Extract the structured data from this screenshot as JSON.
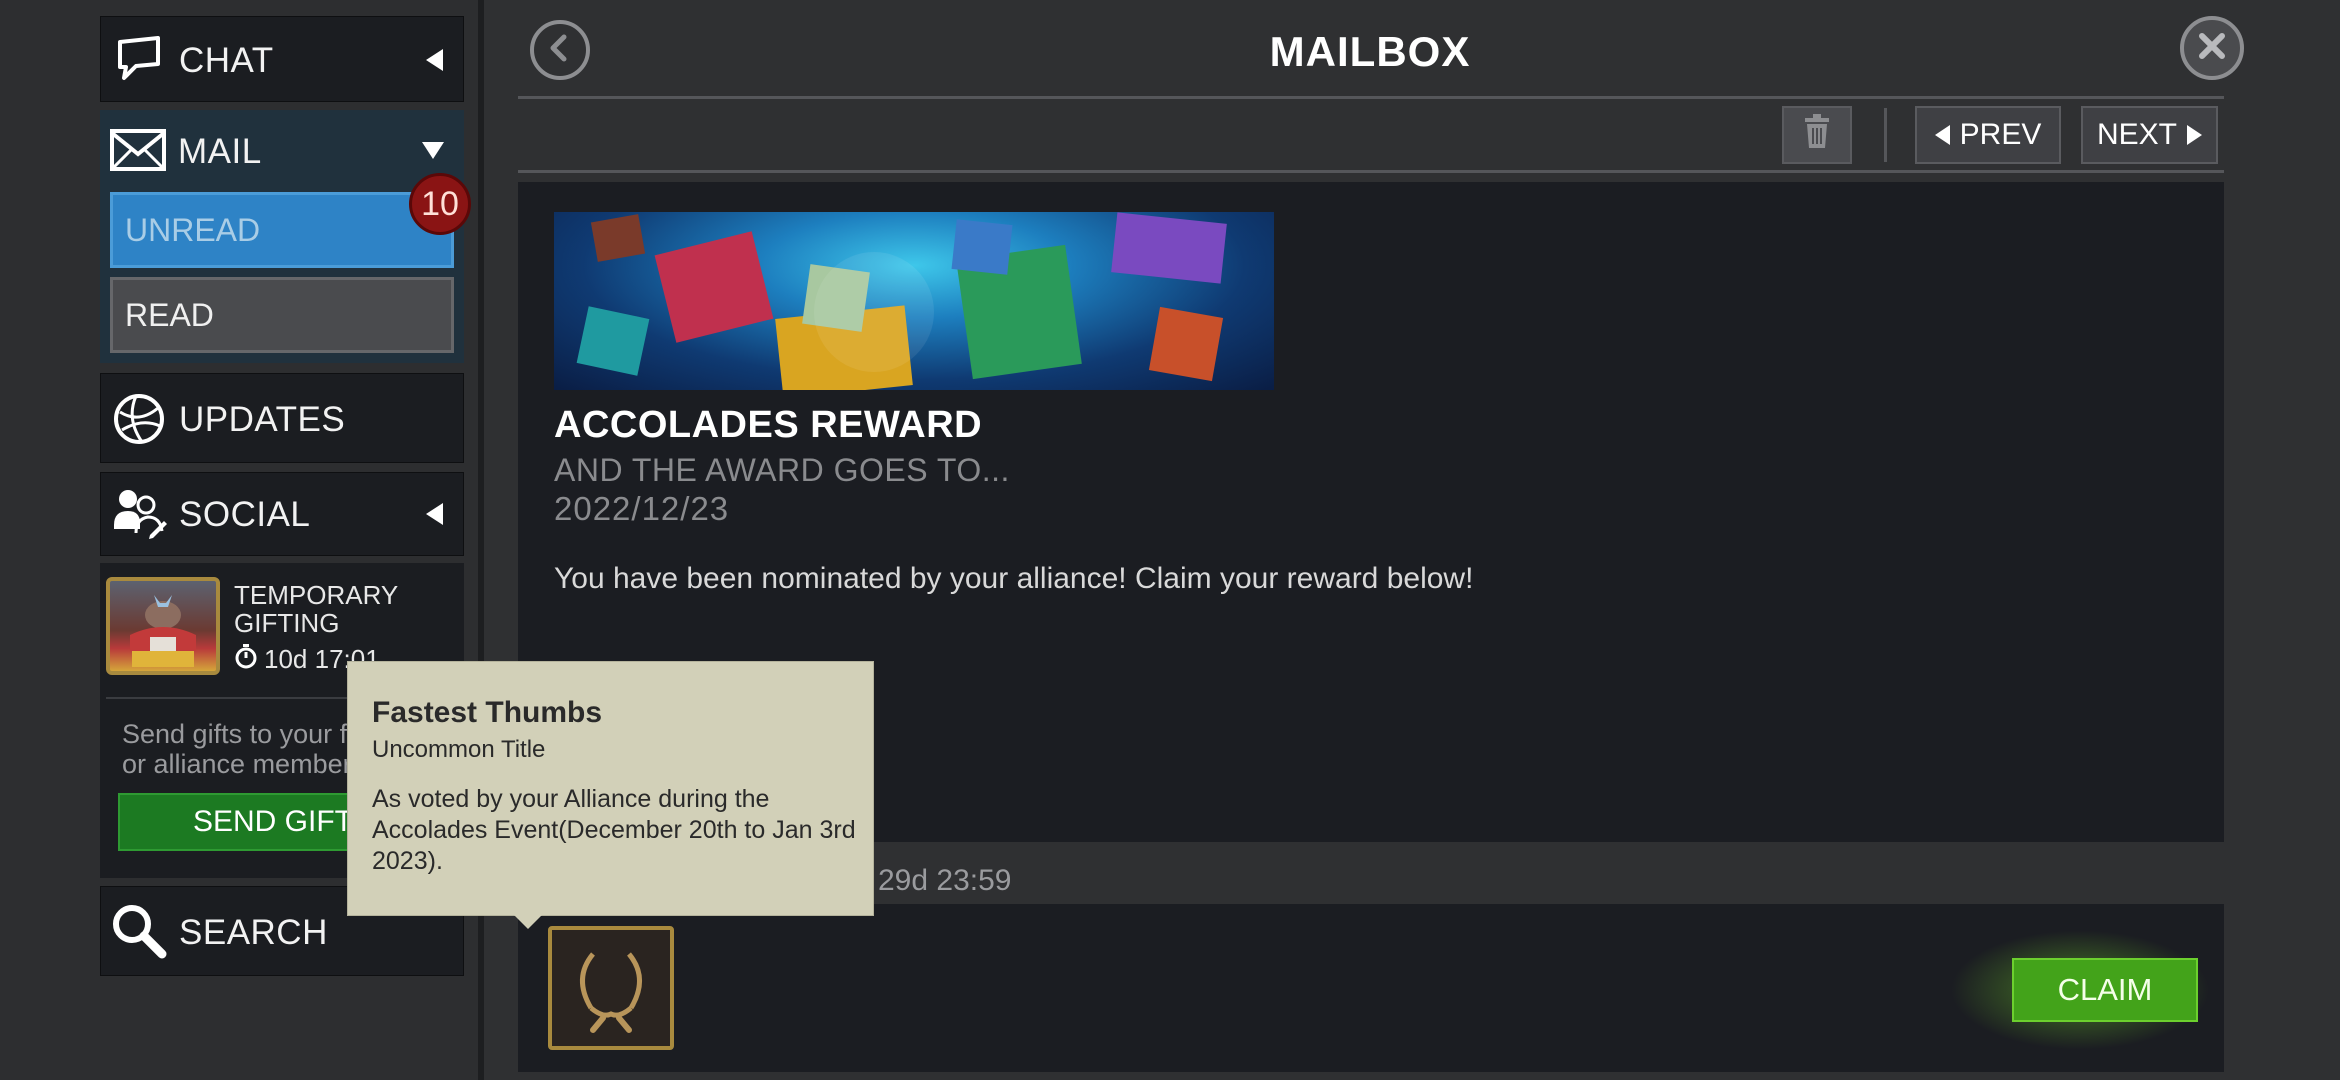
{
  "sidebar": {
    "chat_label": "CHAT",
    "mail_label": "MAIL",
    "unread_label": "UNREAD",
    "read_label": "READ",
    "unread_count": "10",
    "updates_label": "UPDATES",
    "social_label": "SOCIAL",
    "gifting": {
      "title": "TEMPORARY GIFTING",
      "timer": "10d 17:01",
      "description": "Send gifts to your friends or alliance members",
      "send_button": "SEND GIFTS"
    },
    "search_label": "SEARCH"
  },
  "header": {
    "title": "MAILBOX"
  },
  "toolbar": {
    "prev_label": "PREV",
    "next_label": "NEXT"
  },
  "mail": {
    "title": "ACCOLADES REWARD",
    "subtitle": "AND THE AWARD GOES TO...",
    "date": "2022/12/23",
    "body": "You have been nominated by your alliance! Claim your reward below!",
    "expiry": "29d 23:59",
    "claim_label": "CLAIM"
  },
  "tooltip": {
    "title": "Fastest Thumbs",
    "subtitle": "Uncommon Title",
    "body": "As voted by your Alliance during the Accolades Event(December 20th to Jan 3rd 2023)."
  },
  "icons": {
    "chat": "chat-bubble-icon",
    "mail": "envelope-icon",
    "updates": "globe-icon",
    "social": "people-icon",
    "search": "magnifier-icon",
    "back": "back-arrow-icon",
    "close": "close-icon",
    "trash": "trash-icon",
    "timer": "stopwatch-icon",
    "reward": "laurel-wreath-icon"
  },
  "colors": {
    "unread_tab": "#2e83c6",
    "badge": "#8a1414",
    "claim": "#43a31a",
    "send_gifts": "#1c7a22",
    "tooltip_bg": "#d2d0b8"
  }
}
